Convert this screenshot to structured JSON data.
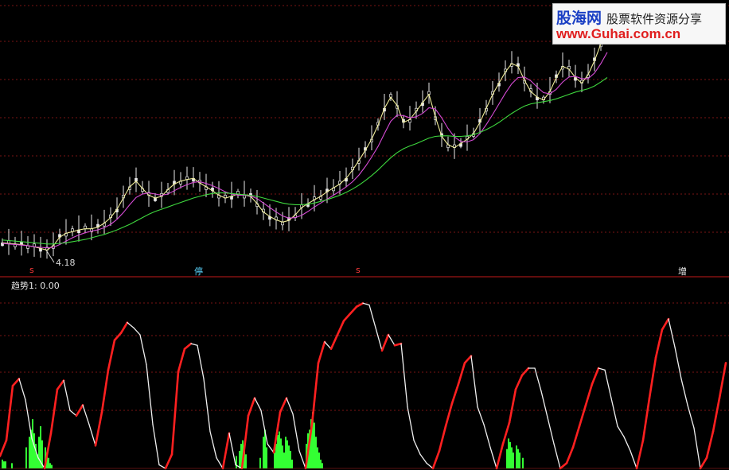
{
  "watermark": {
    "site_name": "股海网",
    "slogan": "股票软件资源分享",
    "url": "www.Guhai.com.cn"
  },
  "colors": {
    "background": "#000000",
    "grid": "#7a1414",
    "candle_up": "#e8e8e8",
    "ma_short": "#f2ef9a",
    "ma_mid": "#d64bd6",
    "ma_long": "#3ed83e",
    "trend_rising": "#ff2020",
    "trend_falling": "#f0f0f0",
    "histogram": "#33ff33",
    "marker_s": "#ff3b3b",
    "marker_ting": "#5ad6ff",
    "marker_zeng": "#f0f0f0",
    "low_label": "#dcdcdc"
  },
  "chart_data": [
    {
      "type": "line",
      "panel": "price",
      "x_index": [
        0,
        8,
        16,
        24,
        32,
        40,
        48,
        56,
        64,
        72,
        80,
        88,
        96,
        104,
        112,
        120,
        128,
        136,
        144,
        152,
        160,
        168,
        176,
        184,
        192,
        200,
        208,
        216,
        224,
        232,
        240,
        248,
        256,
        264,
        272,
        280,
        288,
        296,
        304,
        312,
        320,
        328,
        336,
        344,
        352,
        360,
        368,
        376,
        384,
        392,
        400,
        408,
        416,
        424,
        432,
        440,
        448,
        456,
        464,
        472,
        480,
        488,
        496,
        504,
        512,
        520,
        528,
        536,
        544,
        552,
        560,
        568,
        576,
        584,
        592,
        600,
        608,
        616,
        624,
        632,
        640,
        648,
        656,
        664,
        672,
        680,
        688,
        696,
        704,
        712,
        720,
        728,
        736,
        744,
        752,
        760,
        768,
        776,
        784,
        792,
        800,
        808,
        816,
        824,
        832,
        840,
        848,
        856,
        864,
        872,
        880,
        888,
        896,
        904,
        912
      ],
      "series": [
        {
          "values": [
            4.35,
            4.34,
            4.33,
            4.32,
            4.3,
            4.28,
            4.25,
            4.22,
            4.3,
            4.45,
            4.52,
            4.55,
            4.58,
            4.6,
            4.6,
            4.63,
            4.7,
            4.8,
            4.95,
            5.15,
            5.35,
            5.45,
            5.32,
            5.2,
            5.15,
            5.18,
            5.3,
            5.4,
            5.45,
            5.48,
            5.5,
            5.42,
            5.35,
            5.28,
            5.2,
            5.15,
            5.18,
            5.22,
            5.2,
            5.18,
            5.05,
            4.9,
            4.82,
            4.76,
            4.72,
            4.75,
            4.85,
            4.98,
            5.05,
            5.12,
            5.18,
            5.26,
            5.33,
            5.4,
            5.5,
            5.65,
            5.82,
            6.0,
            6.2,
            6.45,
            6.75,
            6.95,
            6.8,
            6.5,
            6.55,
            6.7,
            6.85,
            7.0,
            6.6,
            6.25,
            6.1,
            6.05,
            6.12,
            6.2,
            6.3,
            6.5,
            6.75,
            7.0,
            7.2,
            7.4,
            7.55,
            7.5,
            7.25,
            7.05,
            6.95,
            6.9,
            7.05,
            7.3,
            7.5,
            7.45,
            7.3,
            7.2,
            7.35,
            7.6,
            7.9,
            8.15
          ]
        },
        {
          "values": [
            4.34,
            4.33,
            4.32,
            4.31,
            4.3,
            4.28,
            4.27,
            4.26,
            4.27,
            4.32,
            4.38,
            4.44,
            4.49,
            4.53,
            4.56,
            4.58,
            4.62,
            4.68,
            4.77,
            4.89,
            5.03,
            5.16,
            5.22,
            5.24,
            5.22,
            5.2,
            5.22,
            5.28,
            5.34,
            5.39,
            5.43,
            5.44,
            5.41,
            5.37,
            5.32,
            5.26,
            5.22,
            5.2,
            5.2,
            5.19,
            5.14,
            5.06,
            4.98,
            4.9,
            4.83,
            4.79,
            4.8,
            4.84,
            4.91,
            4.99,
            5.06,
            5.13,
            5.2,
            5.27,
            5.35,
            5.44,
            5.56,
            5.71,
            5.88,
            6.07,
            6.3,
            6.52,
            6.63,
            6.62,
            6.58,
            6.6,
            6.66,
            6.76,
            6.74,
            6.58,
            6.39,
            6.24,
            6.16,
            6.15,
            6.19,
            6.3,
            6.46,
            6.64,
            6.83,
            7.02,
            7.19,
            7.3,
            7.31,
            7.24,
            7.13,
            7.03,
            7.01,
            7.09,
            7.22,
            7.31,
            7.32,
            7.28,
            7.28,
            7.38,
            7.55,
            7.75
          ]
        },
        {
          "values": [
            4.4,
            4.39,
            4.38,
            4.37,
            4.36,
            4.35,
            4.34,
            4.33,
            4.33,
            4.34,
            4.35,
            4.37,
            4.39,
            4.41,
            4.44,
            4.47,
            4.5,
            4.54,
            4.58,
            4.63,
            4.68,
            4.74,
            4.8,
            4.86,
            4.91,
            4.95,
            4.99,
            5.03,
            5.07,
            5.11,
            5.15,
            5.18,
            5.21,
            5.23,
            5.24,
            5.24,
            5.23,
            5.22,
            5.21,
            5.2,
            5.18,
            5.15,
            5.12,
            5.09,
            5.06,
            5.04,
            5.03,
            5.03,
            5.04,
            5.06,
            5.09,
            5.12,
            5.16,
            5.2,
            5.25,
            5.31,
            5.38,
            5.46,
            5.55,
            5.65,
            5.76,
            5.87,
            5.96,
            6.03,
            6.08,
            6.12,
            6.17,
            6.22,
            6.25,
            6.26,
            6.26,
            6.25,
            6.25,
            6.26,
            6.28,
            6.32,
            6.37,
            6.43,
            6.5,
            6.58,
            6.66,
            6.73,
            6.79,
            6.83,
            6.85,
            6.87,
            6.89,
            6.92,
            6.96,
            7.0,
            7.04,
            7.07,
            7.1,
            7.15,
            7.22,
            7.3
          ]
        }
      ],
      "low_annotation": {
        "text": "4.18"
      }
    },
    {
      "type": "line",
      "panel": "indicator",
      "title": "趋势1: 0.00",
      "ylim": [
        0,
        100
      ],
      "trend_x": [
        0,
        8,
        16,
        24,
        32,
        40,
        48,
        56,
        64,
        72,
        80,
        88,
        96,
        104,
        112,
        120,
        128,
        136,
        144,
        152,
        160,
        168,
        176,
        184,
        192,
        200,
        208,
        216,
        224,
        232,
        240,
        248,
        256,
        264,
        272,
        280,
        288,
        296,
        304,
        312,
        320,
        328,
        336,
        344,
        352,
        360,
        368,
        376,
        384,
        392,
        400,
        408,
        416,
        424,
        432,
        440,
        448,
        456,
        464,
        472,
        480,
        488,
        496,
        504,
        512,
        520,
        528,
        536,
        544,
        552,
        560,
        568,
        576,
        584,
        592,
        600,
        608,
        616,
        624,
        632,
        640,
        648,
        656,
        664,
        672,
        680,
        688,
        696,
        704,
        712,
        720,
        728,
        736,
        744,
        752,
        760,
        768,
        776,
        784,
        792,
        800,
        808,
        816,
        824,
        832,
        840,
        848,
        856,
        864,
        872,
        880,
        888,
        896,
        904,
        912
      ],
      "trend_values": [
        7,
        16,
        47,
        51,
        39,
        17,
        6,
        0,
        20,
        45,
        50,
        33,
        30,
        36,
        25,
        13,
        32,
        56,
        73,
        77,
        83,
        80,
        76,
        59,
        25,
        2,
        0,
        8,
        55,
        68,
        71,
        70,
        51,
        21,
        6,
        0,
        20,
        2,
        0,
        30,
        40,
        33,
        14,
        9,
        32,
        40,
        31,
        10,
        0,
        25,
        60,
        72,
        68,
        76,
        84,
        88,
        92,
        94,
        93,
        80,
        67,
        76,
        70,
        71,
        35,
        16,
        8,
        3,
        0,
        10,
        24,
        37,
        48,
        60,
        64,
        35,
        25,
        12,
        0,
        14,
        26,
        45,
        53,
        57,
        57,
        44,
        29,
        14,
        0,
        3,
        12,
        24,
        36,
        48,
        57,
        56,
        40,
        24,
        18,
        10,
        0,
        16,
        40,
        63,
        79,
        85,
        69,
        51,
        36,
        23,
        0,
        6,
        21,
        40,
        60
      ],
      "trend_rising": [
        true,
        true,
        true,
        true,
        false,
        false,
        false,
        false,
        true,
        true,
        true,
        false,
        false,
        true,
        false,
        false,
        true,
        true,
        true,
        true,
        true,
        false,
        false,
        false,
        false,
        false,
        false,
        true,
        true,
        true,
        true,
        false,
        false,
        false,
        false,
        false,
        true,
        false,
        false,
        true,
        true,
        false,
        false,
        false,
        true,
        true,
        false,
        false,
        false,
        true,
        true,
        true,
        false,
        true,
        true,
        true,
        true,
        true,
        false,
        false,
        false,
        true,
        false,
        true,
        false,
        false,
        false,
        false,
        false,
        true,
        true,
        true,
        true,
        true,
        true,
        false,
        false,
        false,
        false,
        true,
        true,
        true,
        true,
        true,
        false,
        false,
        false,
        false,
        false,
        true,
        true,
        true,
        true,
        true,
        true,
        false,
        false,
        false,
        false,
        false,
        false,
        true,
        true,
        true,
        true,
        true,
        false,
        false,
        false,
        false,
        false,
        true,
        true,
        true,
        true
      ],
      "histogram_x": [
        2,
        4,
        6,
        14,
        32,
        36,
        38,
        40,
        42,
        44,
        46,
        48,
        50,
        52,
        56,
        58,
        60,
        62,
        64,
        296,
        300,
        302,
        304,
        306,
        308,
        326,
        330,
        332,
        334,
        344,
        346,
        348,
        350,
        352,
        354,
        356,
        358,
        360,
        362,
        364,
        366,
        384,
        386,
        388,
        390,
        392,
        394,
        396,
        398,
        400,
        402,
        404,
        636,
        638,
        640,
        642,
        644,
        648,
        650,
        652,
        656
      ],
      "histogram_values": [
        5,
        4,
        4,
        3,
        12,
        18,
        22,
        28,
        20,
        14,
        8,
        18,
        24,
        16,
        12,
        9,
        6,
        3,
        2,
        7,
        10,
        14,
        16,
        13,
        8,
        6,
        18,
        22,
        12,
        9,
        14,
        19,
        21,
        17,
        13,
        9,
        18,
        16,
        13,
        10,
        5,
        14,
        20,
        22,
        28,
        32,
        26,
        18,
        12,
        9,
        5,
        3,
        11,
        17,
        15,
        12,
        9,
        13,
        11,
        9,
        6
      ]
    }
  ],
  "markers": [
    {
      "label": "s",
      "color_key": "marker_s"
    },
    {
      "label": "停",
      "color_key": "marker_ting"
    },
    {
      "label": "s",
      "color_key": "marker_s"
    },
    {
      "label": "增",
      "color_key": "marker_zeng"
    }
  ]
}
